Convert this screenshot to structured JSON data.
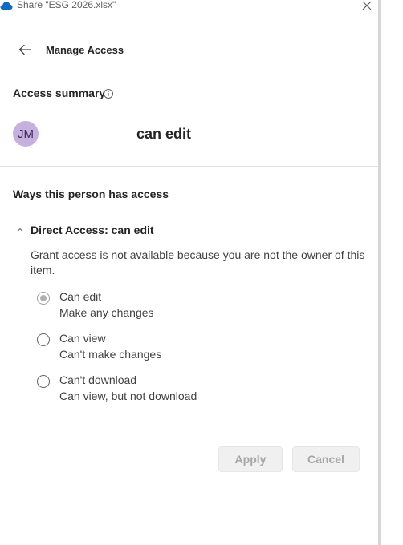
{
  "window": {
    "title": "Share \"ESG 2026.xlsx\""
  },
  "header": {
    "title": "Manage Access"
  },
  "summary": {
    "label": "Access summary",
    "avatar_initials": "JM",
    "permission": "can edit"
  },
  "ways": {
    "heading": "Ways this person has access"
  },
  "direct": {
    "title": "Direct Access: can edit",
    "note": "Grant access is not available because you are not the owner of this item.",
    "options": [
      {
        "label": "Can edit",
        "description": "Make any changes",
        "selected": true
      },
      {
        "label": "Can view",
        "description": "Can't make changes",
        "selected": false
      },
      {
        "label": "Can't download",
        "description": "Can view, but not download",
        "selected": false
      }
    ]
  },
  "buttons": {
    "apply": "Apply",
    "cancel": "Cancel"
  },
  "colors": {
    "avatar_bg": "#c6b1de",
    "cloud": "#0f6cbd",
    "disabled_button": "#f0f0f0"
  },
  "icons": [
    "cloud-icon",
    "close-icon",
    "back-arrow-icon",
    "info-icon",
    "chevron-up-icon"
  ]
}
